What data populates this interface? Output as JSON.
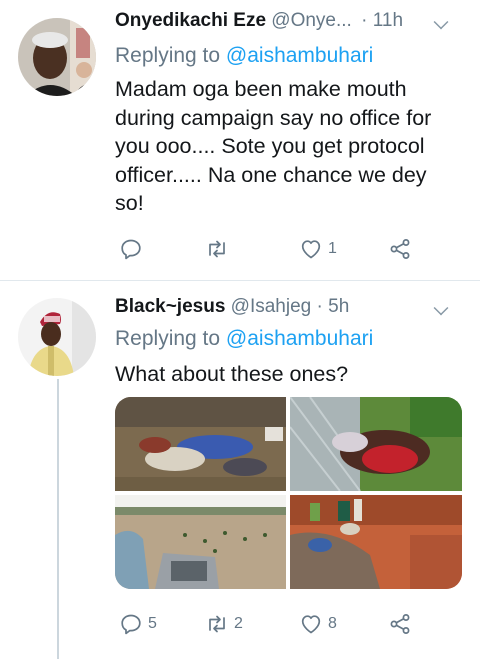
{
  "colors": {
    "accent": "#1da1f2",
    "secondary_text": "#657786",
    "primary_text": "#14171a",
    "divider": "#e1e8ed"
  },
  "tweets": [
    {
      "name": "Onyedikachi Eze",
      "handle": "@Onye...",
      "time": "· 11h",
      "replying_label": "Replying to",
      "replying_to": "@aishambuhari",
      "text": "Madam oga been make mouth\nduring campaign say no office for\nyou ooo.... Sote you get protocol\nofficer..... Na one chance we dey\nso!",
      "replies": "",
      "retweets": "",
      "likes": "1"
    },
    {
      "name": "Black~jesus",
      "handle": "@Isahjeg",
      "time": "· 5h",
      "replying_label": "Replying to",
      "replying_to": "@aishambuhari",
      "text": "What about these ones?",
      "replies": "5",
      "retweets": "2",
      "likes": "8",
      "media": [
        "photo-1",
        "photo-2",
        "photo-3",
        "photo-4"
      ]
    }
  ],
  "icons": [
    "reply-icon",
    "retweet-icon",
    "like-icon",
    "share-icon",
    "caret-down-icon"
  ]
}
